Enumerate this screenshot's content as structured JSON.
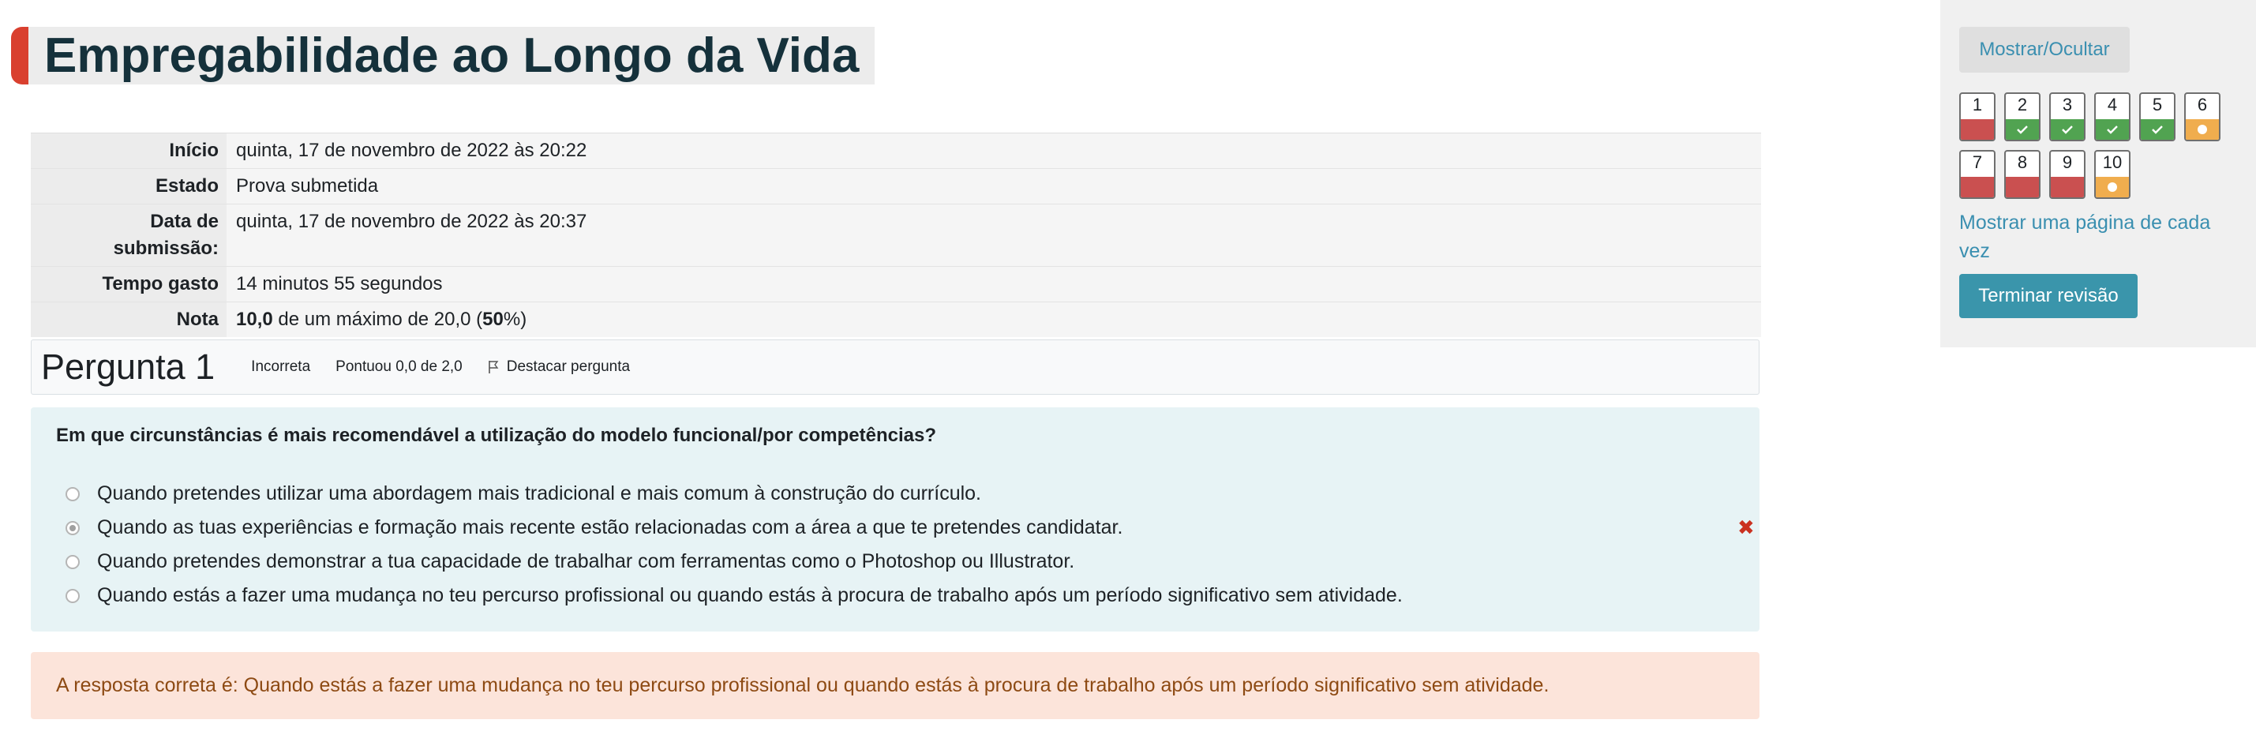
{
  "page": {
    "title": "Empregabilidade ao Longo da Vida"
  },
  "summary": [
    {
      "label": "Início",
      "value": "quinta, 17 de novembro de 2022 às 20:22"
    },
    {
      "label": "Estado",
      "value": "Prova submetida"
    },
    {
      "label": "Data de submissão:",
      "value": "quinta, 17 de novembro de 2022 às 20:37"
    },
    {
      "label": "Tempo gasto",
      "value": "14 minutos 55 segundos"
    },
    {
      "label": "Nota",
      "value_score": "10,0",
      "value_mid": " de um máximo de 20,0 (",
      "value_pct": "50",
      "value_end": "%)"
    }
  ],
  "question": {
    "number": "Pergunta 1",
    "status": "Incorreta",
    "score": "Pontuou 0,0 de 2,0",
    "flag_label": "Destacar pergunta",
    "text": "Em que circunstâncias é mais recomendável a utilização do modelo funcional/por competências?",
    "answers": [
      {
        "text": "Quando pretendes utilizar uma abordagem mais tradicional e mais comum à construção do currículo.",
        "selected": false
      },
      {
        "text": "Quando as tuas experiências e formação mais recente estão relacionadas com a área a que te pretendes candidatar.",
        "selected": true,
        "mark": "✖"
      },
      {
        "text": "Quando pretendes demonstrar a tua capacidade de trabalhar com ferramentas como o Photoshop ou Illustrator.",
        "selected": false
      },
      {
        "text": "Quando estás a fazer uma mudança no teu percurso profissional ou quando estás à procura de trabalho após um período significativo sem atividade.",
        "selected": false
      }
    ],
    "correct_feedback": "A resposta correta é: Quando estás a fazer uma mudança no teu percurso profissional ou quando estás à procura de trabalho após um período significativo sem atividade."
  },
  "sidebar": {
    "toggle_label": "Mostrar/Ocultar",
    "nav": [
      {
        "n": "1",
        "state": "wrong"
      },
      {
        "n": "2",
        "state": "right"
      },
      {
        "n": "3",
        "state": "right"
      },
      {
        "n": "4",
        "state": "right"
      },
      {
        "n": "5",
        "state": "right"
      },
      {
        "n": "6",
        "state": "partial"
      },
      {
        "n": "7",
        "state": "wrong"
      },
      {
        "n": "8",
        "state": "wrong"
      },
      {
        "n": "9",
        "state": "wrong"
      },
      {
        "n": "10",
        "state": "partial"
      }
    ],
    "page_link": "Mostrar uma página de cada vez",
    "finish_label": "Terminar revisão"
  },
  "colors": {
    "accent": "#d9402f",
    "link": "#3a8fb0",
    "wrong": "#ca5050",
    "right": "#51a351",
    "partial": "#f0ad4e",
    "feedback_bg": "#fce4da",
    "question_bg": "#e7f3f5"
  }
}
